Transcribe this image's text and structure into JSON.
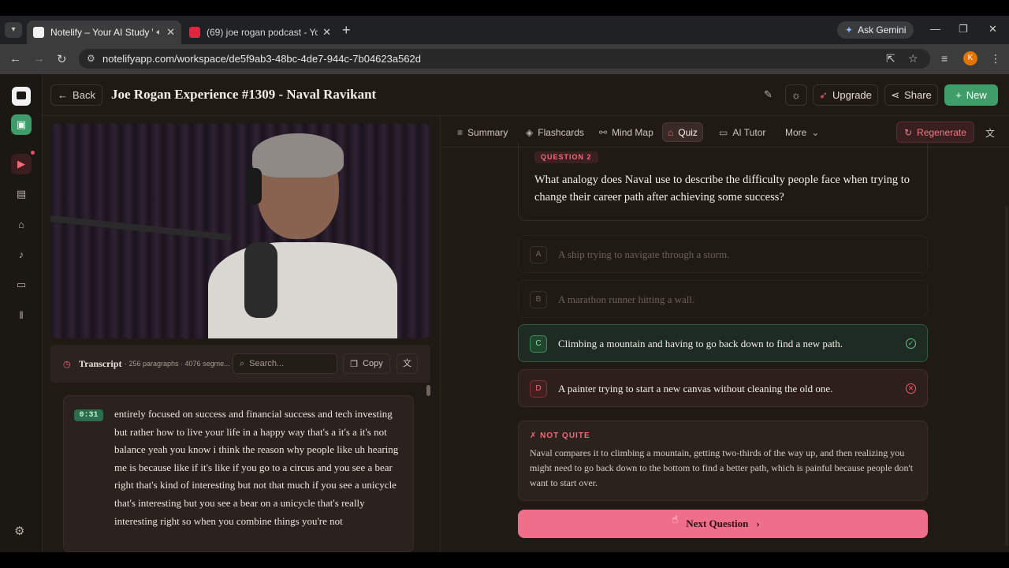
{
  "browser": {
    "tabs": [
      {
        "title": "Notelify – Your AI Study Wo",
        "active": true
      },
      {
        "title": "(69) joe rogan podcast - YouTu",
        "active": false
      }
    ],
    "gemini_label": "Ask Gemini",
    "url": "notelifyapp.com/workspace/de5f9ab3-48bc-4de7-944c-7b04623a562d",
    "profile_initial": "K"
  },
  "header": {
    "back_label": "Back",
    "title": "Joe Rogan Experience #1309 - Naval Ravikant",
    "upgrade_label": "Upgrade",
    "share_label": "Share",
    "new_label": "New"
  },
  "transcript": {
    "label": "Transcript",
    "meta": "· 256 paragraphs · 4076 segme...",
    "search_placeholder": "Search...",
    "copy_label": "Copy",
    "time": "0:31",
    "text": "entirely focused on success and financial success and tech investing but rather how to live your life in a happy way that's a it's a it's not balance yeah you know i think the reason why people like uh hearing me is because like if it's like if you go to a circus and you see a bear right that's kind of interesting but not that much if you see a unicycle that's interesting but you see a bear on a unicycle that's really interesting right so when you combine things you're not"
  },
  "tabs": {
    "summary": "Summary",
    "flashcards": "Flashcards",
    "mindmap": "Mind Map",
    "quiz": "Quiz",
    "aitutor": "AI Tutor",
    "more": "More",
    "regenerate": "Regenerate"
  },
  "quiz": {
    "question_label": "QUESTION 2",
    "question": "What analogy does Naval use to describe the difficulty people face when trying to change their career path after achieving some success?",
    "options": [
      {
        "letter": "A",
        "text": "A ship trying to navigate through a storm.",
        "state": "dim"
      },
      {
        "letter": "B",
        "text": "A marathon runner hitting a wall.",
        "state": "dim"
      },
      {
        "letter": "C",
        "text": "Climbing a mountain and having to go back down to find a new path.",
        "state": "correct"
      },
      {
        "letter": "D",
        "text": "A painter trying to start a new canvas without cleaning the old one.",
        "state": "wrong"
      }
    ],
    "feedback_title": "NOT QUITE",
    "feedback_text": "Naval compares it to climbing a mountain, getting two-thirds of the way up, and then realizing you might need to go back down to the bottom to find a better path, which is painful because people don't want to start over.",
    "next_label": "Next Question"
  },
  "colors": {
    "accent_pink": "#ef6e8a",
    "accent_green": "#3e9d68",
    "background": "#1f1a14"
  }
}
